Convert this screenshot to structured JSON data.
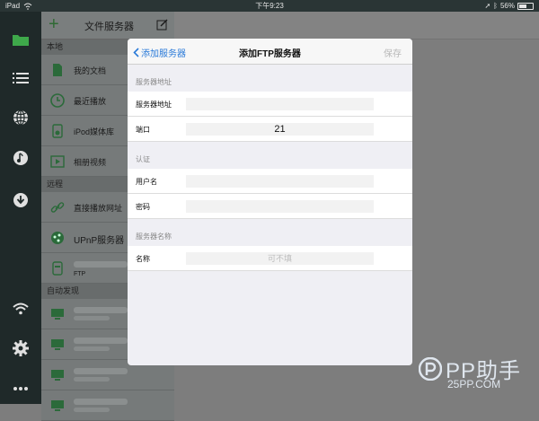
{
  "status_bar": {
    "carrier": "iPad",
    "time": "下午9:23",
    "battery": "56%",
    "battery_level": 0.56
  },
  "rail": {
    "icons": [
      "folder-icon",
      "list-icon",
      "globe-icon",
      "music-icon",
      "download-icon",
      "wifi-icon",
      "gear-icon",
      "more-icon"
    ]
  },
  "sidebar": {
    "title": "文件服务器",
    "sections": {
      "local": "本地",
      "remote": "远程",
      "auto": "自动发现"
    },
    "local_items": [
      {
        "label": "我的文档",
        "icon": "document-icon"
      },
      {
        "label": "最近播放",
        "icon": "clock-icon"
      },
      {
        "label": "iPod媒体库",
        "icon": "ipod-icon"
      },
      {
        "label": "相册视频",
        "icon": "film-icon"
      }
    ],
    "remote_items": [
      {
        "label": "直接播放网址",
        "icon": "link-icon"
      },
      {
        "label": "UPnP服务器",
        "icon": "upnp-icon"
      },
      {
        "sub": "FTP",
        "icon": "server-icon"
      }
    ]
  },
  "modal": {
    "back_label": "添加服务器",
    "title": "添加FTP服务器",
    "save_label": "保存",
    "group1_header": "服务器地址",
    "address_label": "服务器地址",
    "address_value": "",
    "port_label": "端口",
    "port_value": "21",
    "group2_header": "认证",
    "user_label": "用户名",
    "user_value": "",
    "password_label": "密码",
    "password_value": "",
    "group3_header": "服务器名称",
    "name_label": "名称",
    "name_placeholder": "可不填"
  },
  "watermark": {
    "brand": "PP助手",
    "site": "25PP.COM"
  }
}
